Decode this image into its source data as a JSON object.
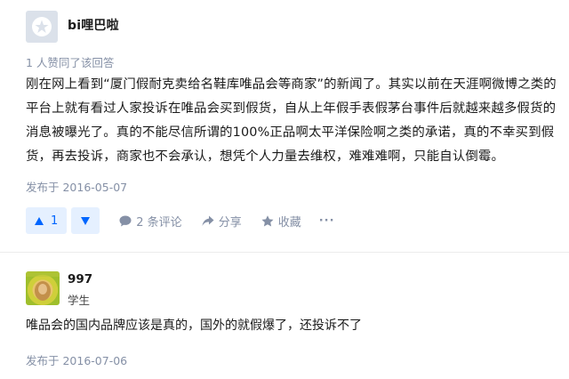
{
  "answer1": {
    "author": "bi哩巴啦",
    "votes_text": "1 人赞同了该回答",
    "content": "刚在网上看到“厦门假耐克卖给名鞋库唯品会等商家”的新闻了。其实以前在天涯啊微博之类的平台上就有看过人家投诉在唯品会买到假货，自从上年假手表假茅台事件后就越来越多假货的消息被曝光了。真的不能尽信所谓的100%正品啊太平洋保险啊之类的承诺，真的不幸买到假货，再去投诉，商家也不会承认，想凭个人力量去维权，难难难啊，只能自认倒霉。",
    "date": "发布于 2016-05-07",
    "actions": {
      "upvote_count": "1",
      "comments": "2 条评论",
      "share": "分享",
      "collect": "收藏",
      "more": "···"
    }
  },
  "answer2": {
    "author": "997",
    "headline": "学生",
    "content": "唯品会的国内品牌应该是真的，国外的就假爆了，还投诉不了",
    "date": "发布于 2016-07-06"
  },
  "colors": {
    "accent": "#0066ff",
    "accent_bg": "#e5f0ff",
    "meta": "#8590a6"
  }
}
